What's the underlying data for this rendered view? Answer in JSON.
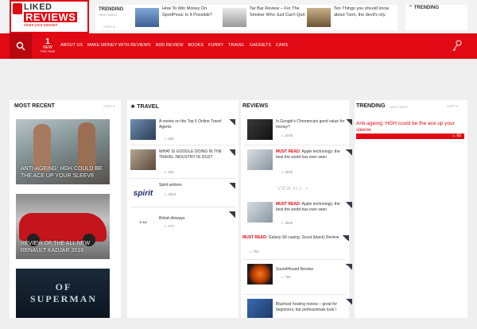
{
  "logo": {
    "liked": "LIKED",
    "reviews": "REVIEWS",
    "tagline": "share your passion"
  },
  "trending_bar": {
    "label": "TRENDING",
    "sub": "HEAT INDEX",
    "sort": "SORT ▾",
    "items": [
      {
        "text": "How To Win Money On SportPesa: Is It Possible?"
      },
      {
        "text": "Tar Bar Review – For The Smoker Who Just Can't Quit"
      },
      {
        "text": "Ten Things you should know about Turin, the devil's city."
      }
    ],
    "right_label": "TRENDING"
  },
  "nav": {
    "new_count": "1",
    "new_label": "NEW",
    "new_sub": "THIS YEAR",
    "items": [
      "ABOUT US",
      "MAKE MONEY WITH REVIEWS",
      "ADD REVIEW",
      "BOOKS",
      "FUNNY",
      "TRAVEL",
      "GADGETS",
      "CARS"
    ]
  },
  "most_recent": {
    "title": "MOST RECENT",
    "sort": "SORT ▾",
    "cards": [
      {
        "caption": "ANTI-AGEING: HGH COULD BE THE ACE UP YOUR SLEEVE"
      },
      {
        "caption": "REVIEW OF THE ALL NEW RENAULT KADJAR 2016"
      },
      {
        "caption": "OF SUPERMAN"
      }
    ]
  },
  "travel": {
    "title": "TRAVEL",
    "items": [
      {
        "title": "A review on the Top 5 Online Travel Agents",
        "count": "260"
      },
      {
        "title": "WHAT IS GOOGLE DOING IN THE TRAVEL INDUSTRY IN 2015?",
        "count": "520"
      },
      {
        "title": "Spirit airlines",
        "count": "3610"
      },
      {
        "title": "British Airways",
        "count": "270"
      }
    ]
  },
  "reviews": {
    "title": "REVIEWS",
    "view_all": "VIEW ALL",
    "items": [
      {
        "must": "",
        "title": "Is Google's Chromecast good value for money?",
        "count": "2240"
      },
      {
        "must": "MUST READ:",
        "title": "Apple technology; the best the world has ever seen",
        "count": "3930"
      },
      {
        "must": "MUST READ:",
        "title": "Apple technology; the best the world has ever seen",
        "count": "3930"
      },
      {
        "must": "MUST READ:",
        "title": "Galaxy S6 casing; Scout (black) Review",
        "count": "750"
      },
      {
        "must": "",
        "title": "SoundHound Review",
        "count": "780"
      },
      {
        "must": "",
        "title": "Bluehost hosting review – great for beginners, but professionals look l",
        "count": ""
      }
    ]
  },
  "trending": {
    "title": "TRENDING",
    "sub": "HEAT INDEX",
    "sort": "SORT ▾",
    "item": "Anti-ageing: HGH could be the ace up your sleeve",
    "count": "65"
  },
  "colors": {
    "accent": "#e10a14",
    "dark_red": "#b8070f"
  }
}
